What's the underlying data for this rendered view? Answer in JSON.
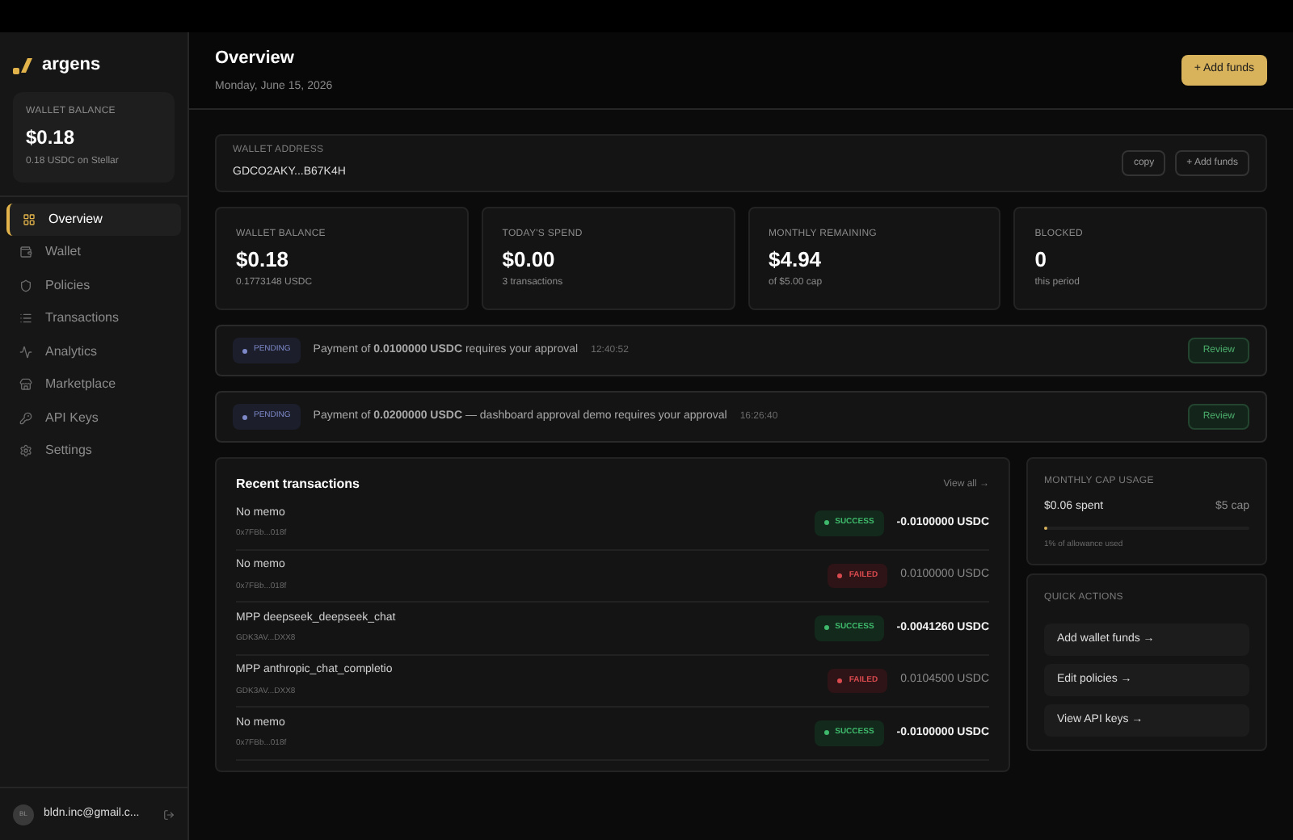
{
  "brand": {
    "name": "argens"
  },
  "sidebar_balance": {
    "label": "WALLET BALANCE",
    "value": "$0.18",
    "sub": "0.18 USDC on Stellar"
  },
  "nav": [
    {
      "label": "Overview",
      "selected": true
    },
    {
      "label": "Wallet",
      "selected": false
    },
    {
      "label": "Policies",
      "selected": false
    },
    {
      "label": "Transactions",
      "selected": false
    },
    {
      "label": "Analytics",
      "selected": false
    },
    {
      "label": "Marketplace",
      "selected": false
    },
    {
      "label": "API Keys",
      "selected": false
    },
    {
      "label": "Settings",
      "selected": false
    }
  ],
  "user": {
    "initials": "BL",
    "email": "bldn.inc@gmail.c..."
  },
  "header": {
    "title": "Overview",
    "date": "Monday, June 15, 2026",
    "button": "+ Add funds"
  },
  "wallet": {
    "label": "WALLET ADDRESS",
    "address": "GDCO2AKY...B67K4H",
    "buttons": [
      "copy",
      "+ Add funds"
    ]
  },
  "stats": [
    {
      "label": "WALLET BALANCE",
      "value": "$0.18",
      "sub": "0.1773148 USDC"
    },
    {
      "label": "TODAY'S SPEND",
      "value": "$0.00",
      "sub": "3 transactions"
    },
    {
      "label": "MONTHLY REMAINING",
      "value": "$4.94",
      "sub": "of $5.00 cap"
    },
    {
      "label": "BLOCKED",
      "value": "0",
      "sub": "this period"
    }
  ],
  "approvals": [
    {
      "badge": "PENDING",
      "message": "Payment of **0.0100000 USDC** requires your approval",
      "time": "12:40:52",
      "button": "Review"
    },
    {
      "badge": "PENDING",
      "message": "Payment of **0.0200000 USDC** — dashboard approval demo requires your approval",
      "time": "16:26:40",
      "button": "Review"
    }
  ],
  "transactions": {
    "title": "Recent transactions",
    "link": "View all →",
    "rows": [
      {
        "memo": "No memo",
        "address": "0x7FBb...018f",
        "status": {
          "kind": "success",
          "label": "SUCCESS"
        },
        "amount": "-0.0100000 USDC"
      },
      {
        "memo": "No memo",
        "address": "0x7FBb...018f",
        "status": {
          "kind": "failed",
          "label": "FAILED"
        },
        "amount": "0.0100000 USDC"
      },
      {
        "memo": "MPP deepseek_deepseek_chat",
        "address": "GDK3AV...DXX8",
        "status": {
          "kind": "success",
          "label": "SUCCESS"
        },
        "amount": "-0.0041260 USDC"
      },
      {
        "memo": "MPP anthropic_chat_completio",
        "address": "GDK3AV...DXX8",
        "status": {
          "kind": "failed",
          "label": "FAILED"
        },
        "amount": "0.0104500 USDC"
      },
      {
        "memo": "No memo",
        "address": "0x7FBb...018f",
        "status": {
          "kind": "success",
          "label": "SUCCESS"
        },
        "amount": "-0.0100000 USDC"
      }
    ]
  },
  "cap": {
    "title": "MONTHLY CAP USAGE",
    "spent": "$0.06 spent",
    "cap": "$5 cap",
    "level": 0.01,
    "note": "1% of allowance used"
  },
  "quick_actions": {
    "title": "QUICK ACTIONS",
    "items": [
      "Add wallet funds →",
      "Edit policies →",
      "View API keys →"
    ]
  }
}
